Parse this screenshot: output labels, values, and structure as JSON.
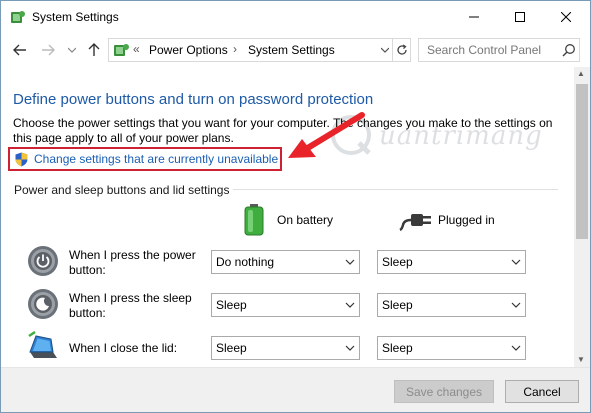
{
  "window": {
    "title": "System Settings"
  },
  "address_bar": {
    "prefix": "«",
    "crumbs": [
      "Power Options",
      "System Settings"
    ],
    "separator": "›"
  },
  "search": {
    "placeholder": "Search Control Panel"
  },
  "content": {
    "heading": "Define power buttons and turn on password protection",
    "description": "Choose the power settings that you want for your computer. The changes you make to the settings on this page apply to all of your power plans.",
    "change_link": "Change settings that are currently unavailable",
    "section_title": "Power and sleep buttons and lid settings",
    "columns": {
      "battery": "On battery",
      "plugged": "Plugged in"
    },
    "rows": [
      {
        "label": "When I press the power button:",
        "battery": "Do nothing",
        "plugged": "Sleep"
      },
      {
        "label": "When I press the sleep button:",
        "battery": "Sleep",
        "plugged": "Sleep"
      },
      {
        "label": "When I close the lid:",
        "battery": "Sleep",
        "plugged": "Sleep"
      }
    ]
  },
  "footer": {
    "save_label": "Save changes",
    "cancel_label": "Cancel"
  },
  "watermark": {
    "text": "uantrimang"
  },
  "colors": {
    "heading": "#1e5aa6",
    "link": "#1a5fb4",
    "highlight_box": "#cc2233",
    "arrow": "#e8232a"
  }
}
